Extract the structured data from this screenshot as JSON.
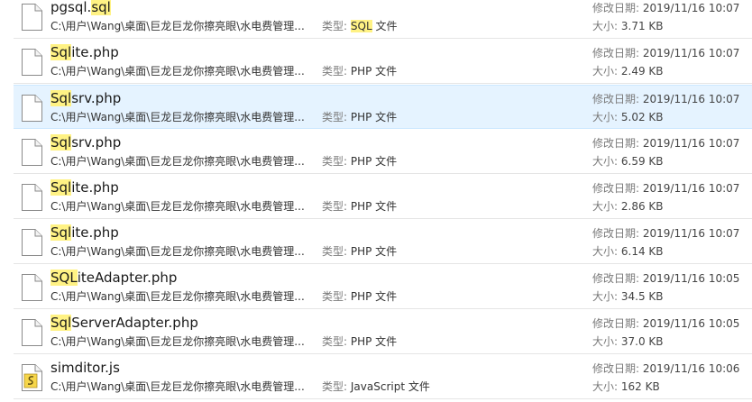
{
  "labels": {
    "type": "类型:",
    "modified": "修改日期:",
    "size": "大小:"
  },
  "files": [
    {
      "name_pre": "pgsql.",
      "name_hl": "sql",
      "name_post": "",
      "path": "C:\\用户\\Wang\\桌面\\巨龙巨龙你擦亮眼\\水电费管理...",
      "type_hl": "SQL",
      "type_post": " 文件",
      "type_pre": "",
      "modified": "2019/11/16 10:07",
      "size": "3.71 KB",
      "icon": "blank-file-icon",
      "selected": false
    },
    {
      "name_pre": "",
      "name_hl": "Sql",
      "name_post": "ite.php",
      "path": "C:\\用户\\Wang\\桌面\\巨龙巨龙你擦亮眼\\水电费管理...",
      "type_pre": "PHP 文件",
      "type_hl": "",
      "type_post": "",
      "modified": "2019/11/16 10:07",
      "size": "2.49 KB",
      "icon": "blank-file-icon",
      "selected": false
    },
    {
      "name_pre": "",
      "name_hl": "Sql",
      "name_post": "srv.php",
      "path": "C:\\用户\\Wang\\桌面\\巨龙巨龙你擦亮眼\\水电费管理...",
      "type_pre": "PHP 文件",
      "type_hl": "",
      "type_post": "",
      "modified": "2019/11/16 10:07",
      "size": "5.02 KB",
      "icon": "blank-file-icon",
      "selected": true
    },
    {
      "name_pre": "",
      "name_hl": "Sql",
      "name_post": "srv.php",
      "path": "C:\\用户\\Wang\\桌面\\巨龙巨龙你擦亮眼\\水电费管理...",
      "type_pre": "PHP 文件",
      "type_hl": "",
      "type_post": "",
      "modified": "2019/11/16 10:07",
      "size": "6.59 KB",
      "icon": "blank-file-icon",
      "selected": false
    },
    {
      "name_pre": "",
      "name_hl": "Sql",
      "name_post": "ite.php",
      "path": "C:\\用户\\Wang\\桌面\\巨龙巨龙你擦亮眼\\水电费管理...",
      "type_pre": "PHP 文件",
      "type_hl": "",
      "type_post": "",
      "modified": "2019/11/16 10:07",
      "size": "2.86 KB",
      "icon": "blank-file-icon",
      "selected": false
    },
    {
      "name_pre": "",
      "name_hl": "Sql",
      "name_post": "ite.php",
      "path": "C:\\用户\\Wang\\桌面\\巨龙巨龙你擦亮眼\\水电费管理...",
      "type_pre": "PHP 文件",
      "type_hl": "",
      "type_post": "",
      "modified": "2019/11/16 10:07",
      "size": "6.14 KB",
      "icon": "blank-file-icon",
      "selected": false
    },
    {
      "name_pre": "",
      "name_hl": "SQL",
      "name_post": "iteAdapter.php",
      "path": "C:\\用户\\Wang\\桌面\\巨龙巨龙你擦亮眼\\水电费管理...",
      "type_pre": "PHP 文件",
      "type_hl": "",
      "type_post": "",
      "modified": "2019/11/16 10:05",
      "size": "34.5 KB",
      "icon": "blank-file-icon",
      "selected": false
    },
    {
      "name_pre": "",
      "name_hl": "Sql",
      "name_post": "ServerAdapter.php",
      "path": "C:\\用户\\Wang\\桌面\\巨龙巨龙你擦亮眼\\水电费管理...",
      "type_pre": "PHP 文件",
      "type_hl": "",
      "type_post": "",
      "modified": "2019/11/16 10:05",
      "size": "37.0 KB",
      "icon": "blank-file-icon",
      "selected": false
    },
    {
      "name_pre": "simditor.js",
      "name_hl": "",
      "name_post": "",
      "path": "C:\\用户\\Wang\\桌面\\巨龙巨龙你擦亮眼\\水电费管理...",
      "type_pre": "JavaScript 文件",
      "type_hl": "",
      "type_post": "",
      "modified": "2019/11/16 10:06",
      "size": "162 KB",
      "icon": "javascript-file-icon",
      "selected": false
    }
  ],
  "colors": {
    "highlight": "#fff284",
    "selected_bg": "#e5f3ff",
    "selected_border": "#cce8ff",
    "divider": "#e5e5e5"
  }
}
